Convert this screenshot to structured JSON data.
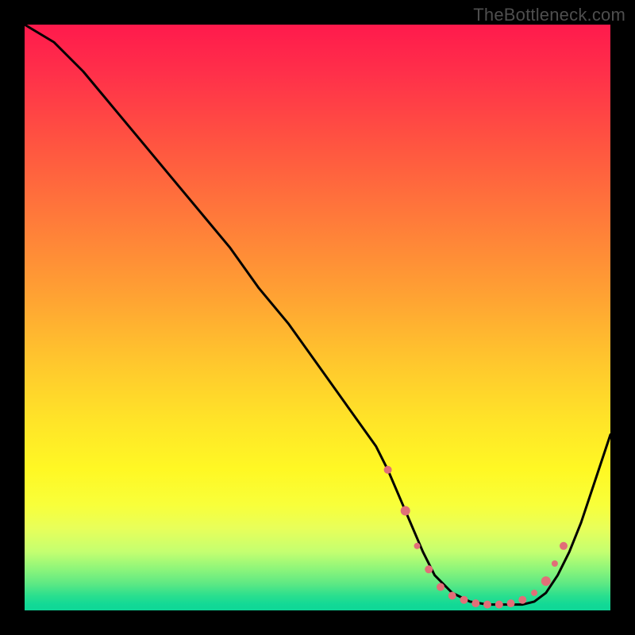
{
  "watermark": "TheBottleneck.com",
  "chart_data": {
    "type": "line",
    "title": "",
    "xlabel": "",
    "ylabel": "",
    "xlim": [
      0,
      100
    ],
    "ylim": [
      0,
      100
    ],
    "background": "red-yellow-green vertical gradient (bottleneck heatmap)",
    "series": [
      {
        "name": "bottleneck-curve",
        "x": [
          0,
          5,
          10,
          15,
          20,
          25,
          30,
          35,
          40,
          45,
          50,
          55,
          60,
          62,
          65,
          68,
          70,
          73,
          76,
          79,
          82,
          85,
          87,
          89,
          91,
          93,
          95,
          97,
          100
        ],
        "values": [
          100,
          97,
          92,
          86,
          80,
          74,
          68,
          62,
          55,
          49,
          42,
          35,
          28,
          24,
          17,
          10,
          6,
          3,
          1.5,
          1,
          1,
          1,
          1.5,
          3,
          6,
          10,
          15,
          21,
          30
        ]
      }
    ],
    "markers": {
      "name": "curve-dots",
      "color": "#e16f78",
      "points": [
        {
          "x": 62,
          "y": 24,
          "r": 5
        },
        {
          "x": 65,
          "y": 17,
          "r": 6
        },
        {
          "x": 67,
          "y": 11,
          "r": 4
        },
        {
          "x": 69,
          "y": 7,
          "r": 5
        },
        {
          "x": 71,
          "y": 4,
          "r": 5
        },
        {
          "x": 73,
          "y": 2.5,
          "r": 5
        },
        {
          "x": 75,
          "y": 1.8,
          "r": 5
        },
        {
          "x": 77,
          "y": 1.2,
          "r": 5
        },
        {
          "x": 79,
          "y": 1,
          "r": 5
        },
        {
          "x": 81,
          "y": 1,
          "r": 5
        },
        {
          "x": 83,
          "y": 1.2,
          "r": 5
        },
        {
          "x": 85,
          "y": 1.8,
          "r": 5
        },
        {
          "x": 87,
          "y": 3,
          "r": 4
        },
        {
          "x": 89,
          "y": 5,
          "r": 6
        },
        {
          "x": 90.5,
          "y": 8,
          "r": 4
        },
        {
          "x": 92,
          "y": 11,
          "r": 5
        }
      ]
    }
  }
}
